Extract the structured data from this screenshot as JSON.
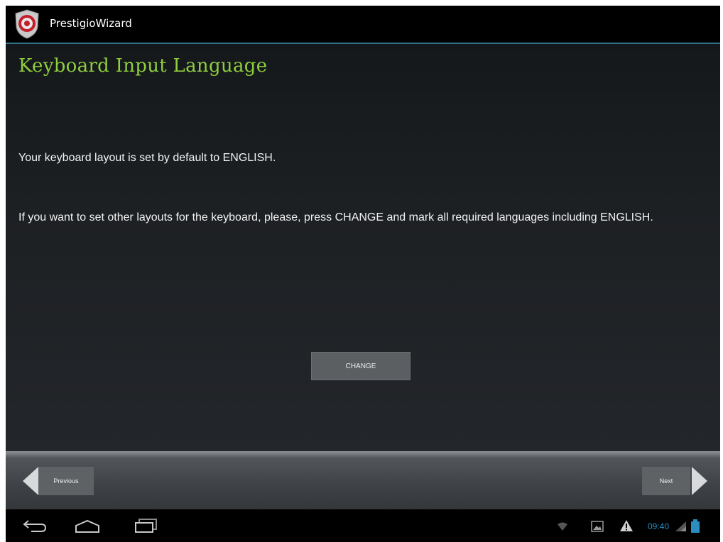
{
  "app": {
    "title": "PrestigioWizard"
  },
  "page": {
    "heading": "Keyboard Input Language",
    "paragraph_1": "Your keyboard layout is set by default to ENGLISH.",
    "paragraph_2": "If you want to set other layouts for the keyboard, please, press CHANGE and mark all required languages including ENGLISH.",
    "change_button": "CHANGE"
  },
  "wizard_nav": {
    "previous_label": "Previous",
    "next_label": "Next"
  },
  "system_bar": {
    "icons": [
      "back-icon",
      "home-icon",
      "recent-apps-icon",
      "wifi-icon",
      "gallery-icon",
      "warning-icon",
      "signal-icon",
      "battery-icon"
    ],
    "clock": "09:40"
  },
  "colors": {
    "heading": "#8fce3c",
    "accent_line": "#33708a",
    "clock": "#2a8fc0"
  }
}
